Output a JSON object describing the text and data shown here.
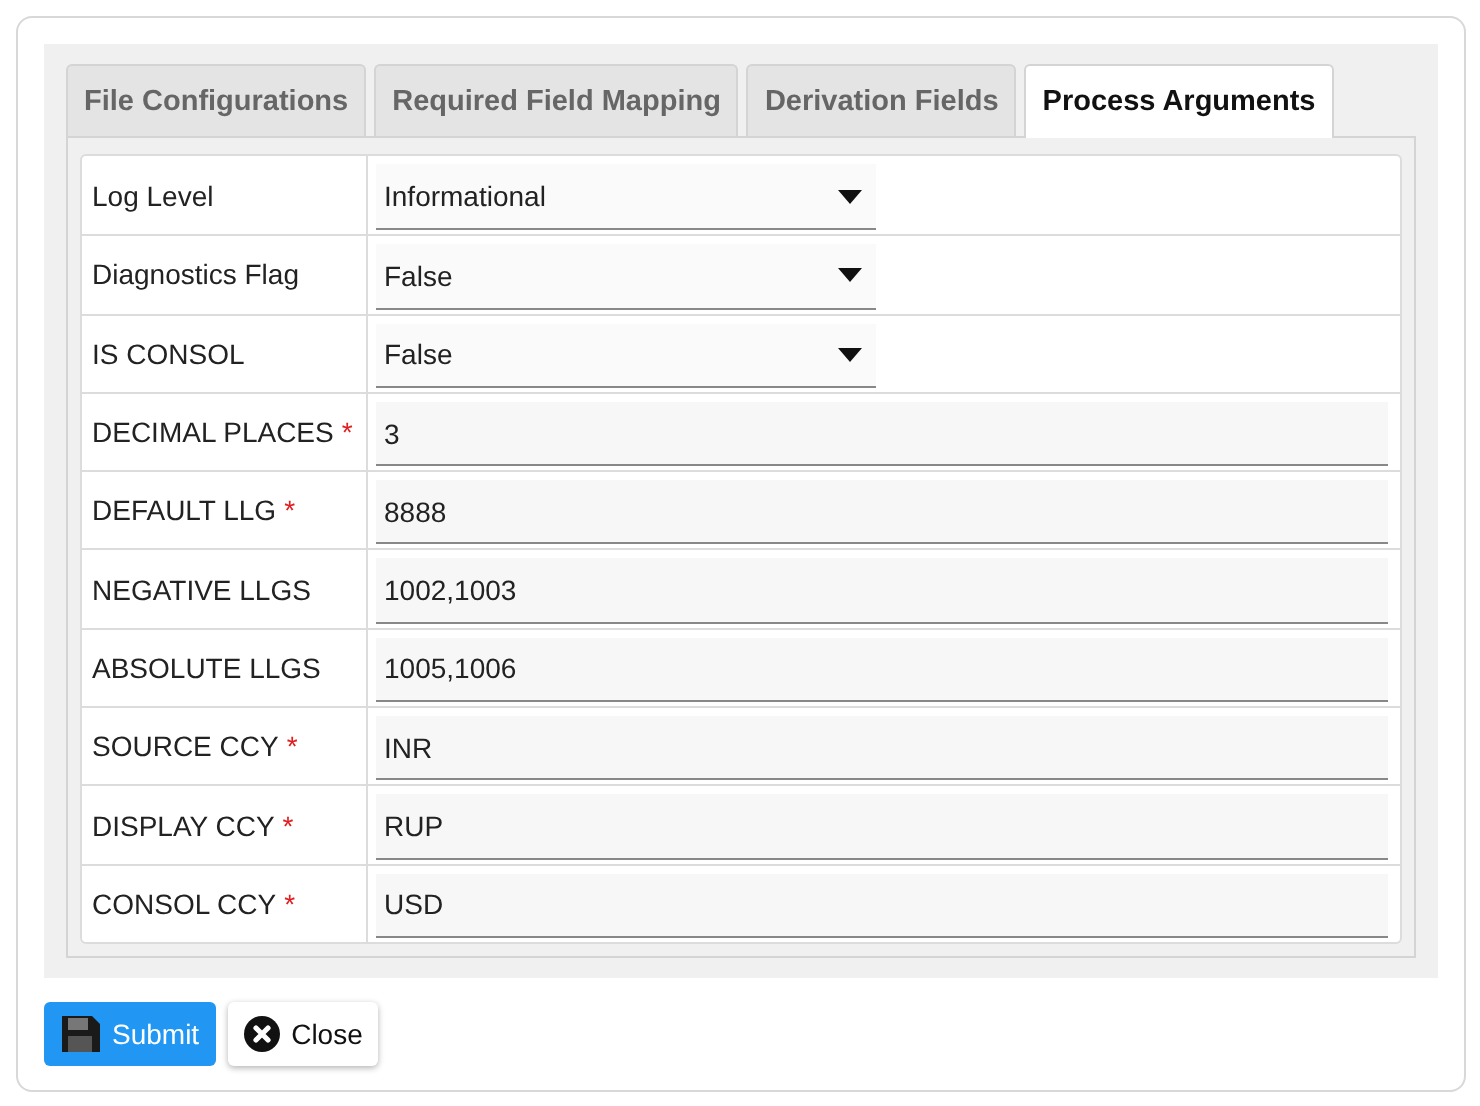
{
  "tabs": [
    {
      "label": "File Configurations",
      "selected": false
    },
    {
      "label": "Required Field Mapping",
      "selected": false
    },
    {
      "label": "Derivation Fields",
      "selected": false
    },
    {
      "label": "Process Arguments",
      "selected": true
    }
  ],
  "fields": [
    {
      "label": "Log Level",
      "kind": "select",
      "value": "Informational"
    },
    {
      "label": "Diagnostics Flag",
      "kind": "select",
      "value": "False"
    },
    {
      "label": "IS CONSOL",
      "kind": "select",
      "value": "False"
    },
    {
      "label": "DECIMAL PLACES",
      "required_mark": "*",
      "kind": "text",
      "value": "3"
    },
    {
      "label": "DEFAULT LLG",
      "required_mark": "*",
      "kind": "text",
      "value": "8888"
    },
    {
      "label": "NEGATIVE LLGS",
      "kind": "text",
      "value": "1002,1003"
    },
    {
      "label": "ABSOLUTE LLGS",
      "kind": "text",
      "value": "1005,1006"
    },
    {
      "label": "SOURCE CCY",
      "required_mark": "*",
      "kind": "text",
      "value": "INR"
    },
    {
      "label": "DISPLAY CCY",
      "required_mark": "*",
      "kind": "text",
      "value": "RUP"
    },
    {
      "label": "CONSOL CCY",
      "required_mark": "*",
      "kind": "text",
      "value": "USD"
    }
  ],
  "buttons": [
    {
      "label": "Submit",
      "kind": "primary"
    },
    {
      "label": "Close",
      "kind": "default"
    }
  ]
}
